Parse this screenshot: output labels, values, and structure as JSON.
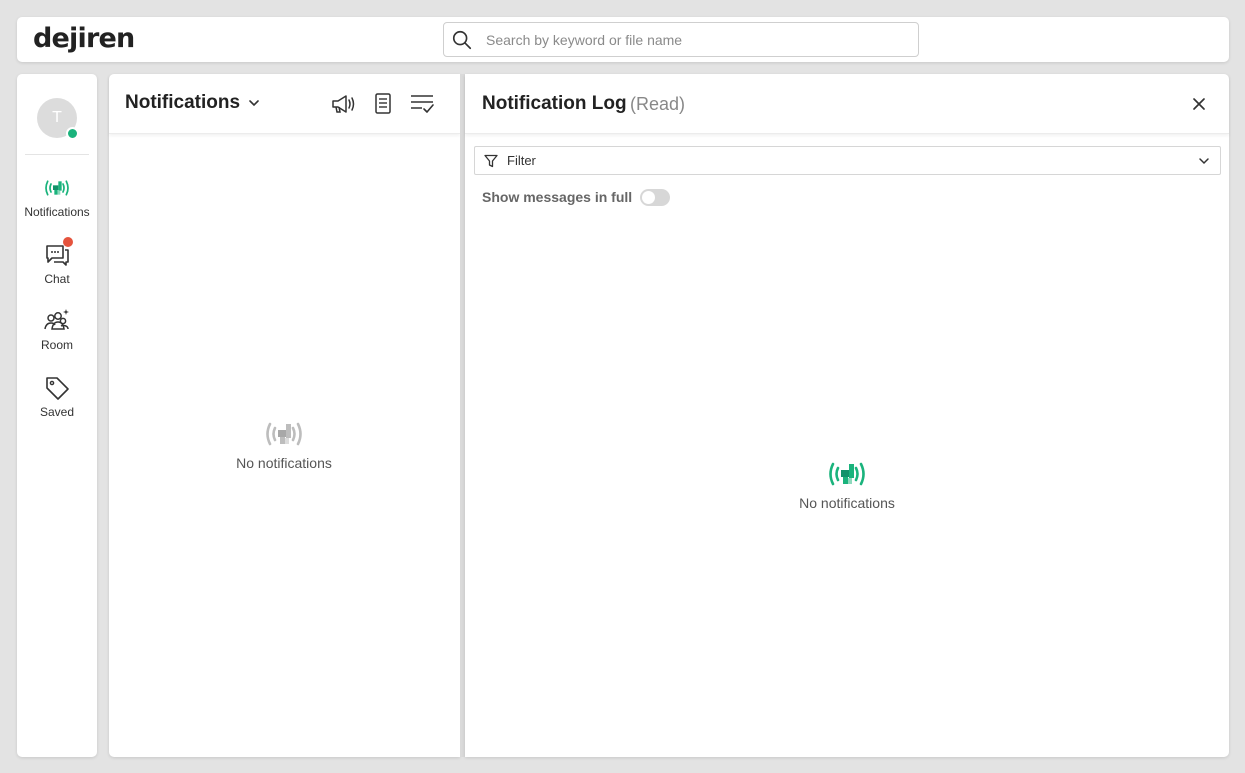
{
  "app": {
    "logo_text": "dejiren"
  },
  "search": {
    "placeholder": "Search by keyword or file name",
    "value": ""
  },
  "user": {
    "avatar_initial": "T",
    "status": "online"
  },
  "sidebar": {
    "items": [
      {
        "label": "Notifications",
        "icon": "broadcast-icon",
        "active": true
      },
      {
        "label": "Chat",
        "icon": "chat-icon",
        "has_unread": true
      },
      {
        "label": "Room",
        "icon": "room-icon"
      },
      {
        "label": "Saved",
        "icon": "tag-icon"
      }
    ]
  },
  "notifications": {
    "title": "Notifications",
    "empty_text": "No notifications",
    "actions": [
      "announcement-icon",
      "notification-log-icon",
      "mark-all-read-icon"
    ]
  },
  "log": {
    "title": "Notification Log",
    "subtitle": "(Read)",
    "filter_label": "Filter",
    "show_full_label": "Show messages in full",
    "show_full_on": false,
    "empty_text": "No notifications"
  },
  "colors": {
    "accent": "#1ab37c",
    "accent_dark": "#12936a",
    "muted_icon": "#bdbdbd",
    "badge": "#e5533d",
    "background": "#e3e3e3"
  }
}
